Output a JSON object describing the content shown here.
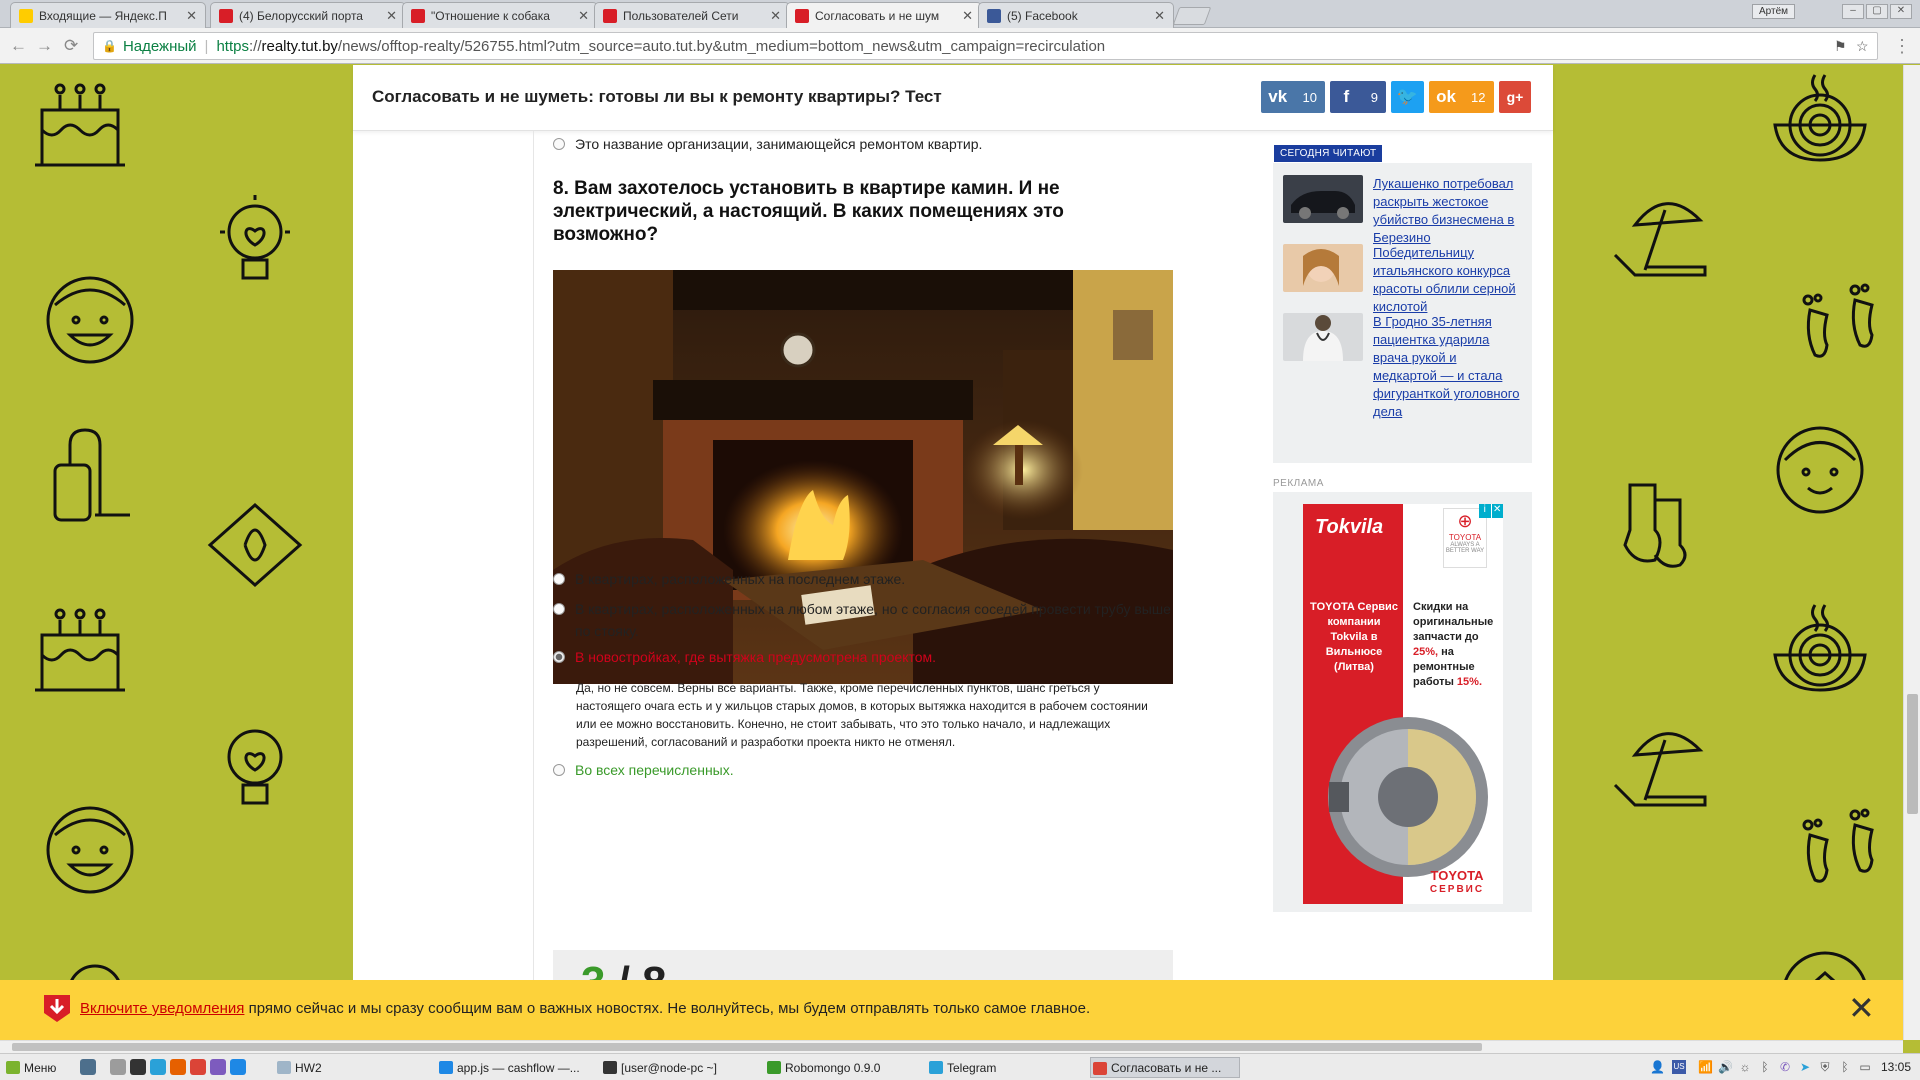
{
  "browser": {
    "tabs": [
      {
        "title": "Входящие — Яндекс.П",
        "icon": "yandex-mail-icon",
        "color": "#ffcc00"
      },
      {
        "title": "(4) Белорусский порта",
        "icon": "tut-by-icon",
        "color": "#d81e27"
      },
      {
        "title": "\"Отношение к собака",
        "icon": "tut-by-icon",
        "color": "#d81e27"
      },
      {
        "title": "Пользователей Сети",
        "icon": "tut-by-icon",
        "color": "#d81e27"
      },
      {
        "title": "Согласовать и не шум",
        "icon": "tut-by-icon",
        "color": "#d81e27"
      },
      {
        "title": "(5) Facebook",
        "icon": "facebook-icon",
        "color": "#3b5998"
      }
    ],
    "profile_name": "Артём",
    "secure_label": "Надежный",
    "url_scheme": "https",
    "url_host": "realty.tut.by",
    "url_path": "/news/offtop-realty/526755.html?utm_source=auto.tut.by&utm_medium=bottom_news&utm_campaign=recirculation"
  },
  "article": {
    "title": "Согласовать и не шуметь: готовы ли вы к ремонту квартиры? Тест",
    "share": [
      {
        "network": "vk",
        "icon": "vk-icon",
        "count": "10",
        "color": "#4a76a8"
      },
      {
        "network": "facebook",
        "icon": "facebook-icon",
        "count": "9",
        "color": "#3b5998"
      },
      {
        "network": "twitter",
        "icon": "twitter-icon",
        "count": "",
        "color": "#1da1f2"
      },
      {
        "network": "odnoklassniki",
        "icon": "odnoklassniki-icon",
        "count": "12",
        "color": "#f59a1b"
      },
      {
        "network": "googleplus",
        "icon": "google-plus-icon",
        "count": "",
        "color": "#dc4a38"
      }
    ]
  },
  "quiz": {
    "prev_option": "Это название организации, занимающейся ремонтом квартир.",
    "question": "8. Вам захотелось установить в квартире камин. И не электрический, а настоящий. В каких помещениях это возможно?",
    "options": [
      {
        "text": "В квартирах, расположенных на последнем этаже.",
        "state": "normal"
      },
      {
        "text": "В квартирах, расположенных на любом этаже, но с согласия соседей провести трубу выше по стояку.",
        "state": "normal"
      },
      {
        "text": "В новостройках, где вытяжка предусмотрена проектом.",
        "state": "selected-wrong"
      },
      {
        "text": "Во всех перечисленных.",
        "state": "correct"
      }
    ],
    "explanation": "Да, но не совсем. Верны все варианты. Также, кроме перечисленных пунктов, шанс греться у настоящего очага есть и у жильцов старых домов, в которых вытяжка находится в рабочем состоянии или ее можно восстановить. Конечно, не стоит забывать, что это только начало, и надлежащих разрешений, согласований и разработки проекта никто не отменял.",
    "score_got": "3",
    "score_total": " / 8",
    "colors": {
      "wrong": "#d0021b",
      "correct": "#3a9a2a"
    }
  },
  "sidebar": {
    "today_label": "СЕГОДНЯ ЧИТАЮТ",
    "items": [
      {
        "title": "Лукашенко потребовал раскрыть жестокое убийство бизнесмена в Березино"
      },
      {
        "title": "Победительницу итальянского конкурса красоты облили серной кислотой"
      },
      {
        "title": "В Гродно 35-летняя пациентка ударила врача рукой и медкартой — и стала фигуранткой уголовного дела"
      }
    ],
    "ad_label": "РЕКЛАМА",
    "ad": {
      "brand": "Tokvila",
      "left_text": "TOYOTA Сервис компании Tokvila в Вильнюсе (Литва)",
      "right_text_1": "Скидки на оригинальные запчасти до",
      "right_pct_1": "25%,",
      "right_text_2": "на ремонтные работы",
      "right_pct_2": "15%.",
      "toyota_top": "TOYOTA",
      "toyota_slogan": "ALWAYS A BETTER WAY",
      "footer_1": "TOYOTA",
      "footer_2": "СЕРВИС"
    }
  },
  "notify": {
    "link": "Включите уведомления",
    "text": " прямо сейчас и мы сразу сообщим вам о важных новостях. Не волнуйтесь, мы будем отправлять только самое главное."
  },
  "taskbar": {
    "menu_label": "Меню",
    "windows": [
      {
        "title": "HW2",
        "icon": "folder-icon"
      },
      {
        "title": "app.js — cashflow —...",
        "icon": "vscode-icon"
      },
      {
        "title": "[user@node-pc ~]",
        "icon": "terminal-icon"
      },
      {
        "title": "Robomongo 0.9.0",
        "icon": "robomongo-icon"
      },
      {
        "title": "Telegram",
        "icon": "telegram-icon"
      },
      {
        "title": "Согласовать и не ...",
        "icon": "chrome-icon"
      }
    ],
    "clock": "13:05"
  },
  "colors": {
    "page_bg": "#b5bd35",
    "notify_bg": "#fdd23a",
    "link": "#1a3da8",
    "accent_blue": "#1a3d9e"
  }
}
